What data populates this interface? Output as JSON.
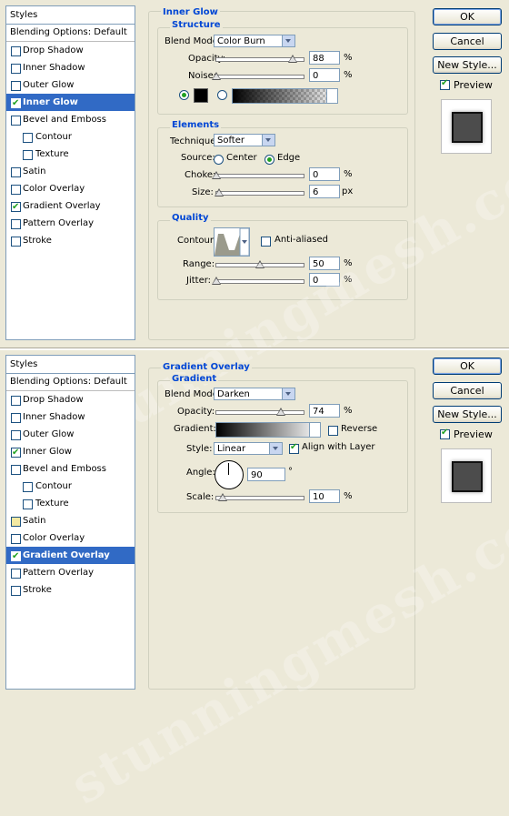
{
  "watermark": "stunningmesh.com",
  "buttons": {
    "ok": "OK",
    "cancel": "Cancel",
    "new_style": "New Style...",
    "preview": "Preview"
  },
  "styles_panel": {
    "header": "Styles",
    "blending": "Blending Options: Default",
    "items": [
      "Drop Shadow",
      "Inner Shadow",
      "Outer Glow",
      "Inner Glow",
      "Bevel and Emboss",
      "Contour",
      "Texture",
      "Satin",
      "Color Overlay",
      "Gradient Overlay",
      "Pattern Overlay",
      "Stroke"
    ]
  },
  "inner_glow": {
    "title": "Inner Glow",
    "structure": "Structure",
    "blend_mode_label": "Blend Mode:",
    "blend_mode": "Color Burn",
    "opacity_label": "Opacity:",
    "opacity": "88",
    "opacity_fraction": 0.88,
    "noise_label": "Noise:",
    "noise": "0",
    "noise_fraction": 0,
    "elements": "Elements",
    "technique_label": "Technique:",
    "technique": "Softer",
    "source_label": "Source:",
    "center": "Center",
    "edge": "Edge",
    "choke_label": "Choke:",
    "choke": "0",
    "size_label": "Size:",
    "size": "6",
    "size_fraction": 0.03,
    "quality": "Quality",
    "contour_label": "Contour:",
    "anti_aliased": "Anti-aliased",
    "range_label": "Range:",
    "range": "50",
    "range_fraction": 0.5,
    "jitter_label": "Jitter:",
    "jitter": "0",
    "pct": "%",
    "px": "px"
  },
  "gradient_overlay": {
    "title": "Gradient Overlay",
    "gradient_heading": "Gradient",
    "blend_mode_label": "Blend Mode:",
    "blend_mode": "Darken",
    "opacity_label": "Opacity:",
    "opacity": "74",
    "opacity_fraction": 0.74,
    "gradient_label": "Gradient:",
    "reverse": "Reverse",
    "style_label": "Style:",
    "style": "Linear",
    "align": "Align with Layer",
    "angle_label": "Angle:",
    "angle": "90",
    "deg": "°",
    "scale_label": "Scale:",
    "scale": "10",
    "scale_fraction": 0.07,
    "pct": "%"
  }
}
